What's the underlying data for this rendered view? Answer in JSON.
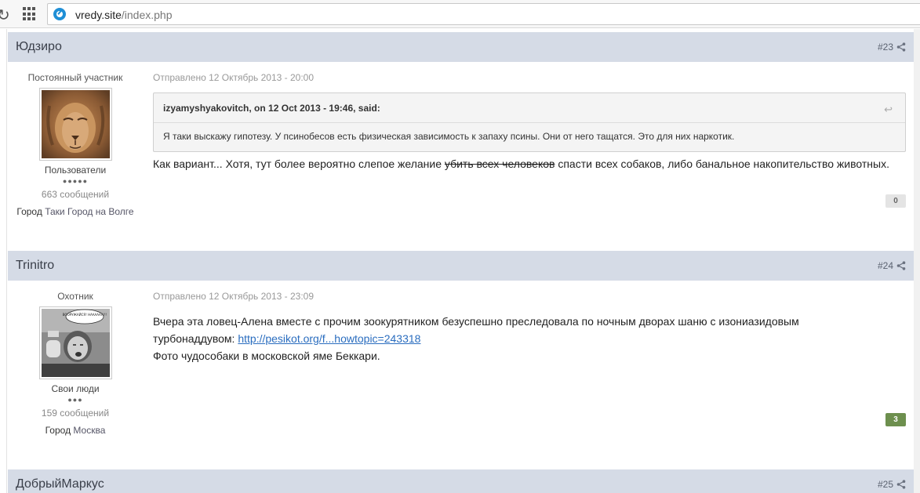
{
  "browser": {
    "url_host": "vredy.site",
    "url_path": "/index.php"
  },
  "posts": [
    {
      "author": "Юдзиро",
      "number": "#23",
      "rank": "Постоянный участник",
      "avatar": "lion-avatar",
      "group": "Пользователи",
      "pips": "●●●●●",
      "post_count": "663 сообщений",
      "city_label": "Город",
      "city": "Таки Город на Волге",
      "date": "Отправлено 12 Октябрь 2013 - 20:00",
      "quote": {
        "citation": "izyamyshyakovitch, on 12 Oct 2013 - 19:46, said:",
        "text": "Я таки выскажу гипотезу. У псинобесов есть физическая зависимость к запаху псины. Они от него тащатся. Это для них наркотик."
      },
      "text_before": "Как вариант... Хотя, тут более вероятно слепое желание ",
      "text_strike": "убить всех человеков",
      "text_after": " спасти всех собаков, либо банальное накопительство животных.",
      "reputation": "0",
      "reputation_color": "#e4e4e4"
    },
    {
      "author": "Trinitro",
      "number": "#24",
      "rank": "Охотник",
      "avatar": "protest-woman-avatar",
      "avatar_caption": "ВООРУЖАЙСЯ! НАААААА!!!",
      "group": "Свои люди",
      "pips": "●●●",
      "post_count": "159 сообщений",
      "city_label": "Город",
      "city": "Москва",
      "date": "Отправлено 12 Октябрь 2013 - 23:09",
      "line1": "Вчера эта ловец-Алена вместе с прочим зоокурятником безуспешно преследовала по ночным дворах шаню с изониазидовым",
      "line2_prefix": "турбонаддувом: ",
      "link": "http://pesikot.org/f...howtopic=243318",
      "line3": "Фото чудособаки в московской яме Беккари.",
      "reputation": "3",
      "reputation_color": "#6d8f4e"
    },
    {
      "author": "ДобрыйМаркус",
      "number": "#25"
    }
  ]
}
